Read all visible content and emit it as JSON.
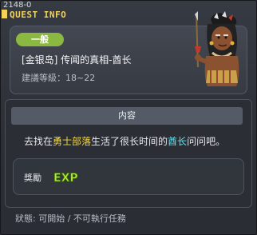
{
  "window": {
    "quest_id": "2148-0",
    "title": "QUEST INFO"
  },
  "quest": {
    "category_badge": "一般",
    "name": "[金银岛] 传闻的真相-酋长",
    "level_text": "建議等級：18~22"
  },
  "content": {
    "section_title": "内容",
    "desc_part1": "去找在",
    "desc_highlight_place": "勇士部落",
    "desc_part2": "生活了很长时间的",
    "desc_highlight_npc": "酋长",
    "desc_part3": "问问吧。"
  },
  "reward": {
    "label": "獎勵",
    "exp_icon_text": "EXP"
  },
  "status": {
    "text": "狀態: 可開始 / 不可執行任務"
  },
  "colors": {
    "badge": "#8ab840",
    "title": "#f3d35a",
    "highlight_place": "#f4d83a",
    "highlight_npc": "#5fe3f0",
    "exp": "#b6f02a"
  },
  "icons": {
    "npc": "tribal-chief-npc-portrait",
    "reward": "exp-icon"
  }
}
